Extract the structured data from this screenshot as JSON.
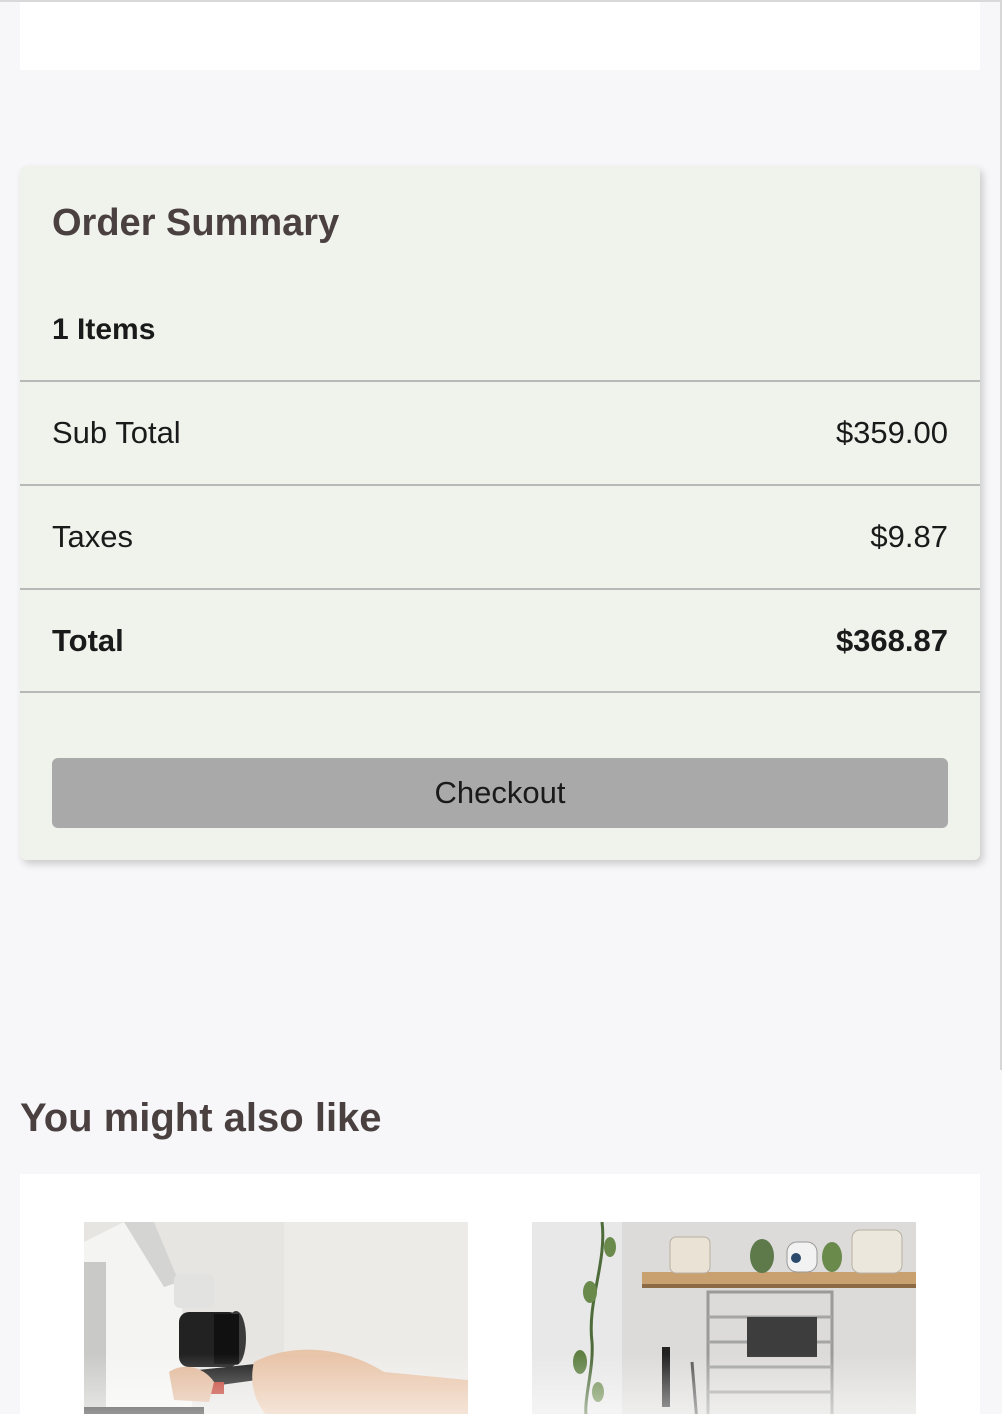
{
  "summary": {
    "title": "Order Summary",
    "items_count": "1 Items",
    "rows": [
      {
        "label": "Sub Total",
        "value": "$359.00"
      },
      {
        "label": "Taxes",
        "value": "$9.87"
      },
      {
        "label": "Total",
        "value": "$368.87"
      }
    ],
    "checkout_label": "Checkout"
  },
  "recommendations": {
    "heading": "You might also like",
    "products": [
      {
        "image": "espresso-machine-photo"
      },
      {
        "image": "kitchen-shelf-rack-photo"
      }
    ]
  },
  "colors": {
    "page_bg": "#f7f7f9",
    "card_bg": "#f0f2ec",
    "heading": "#4a4040",
    "button_bg": "#a9a9a9",
    "divider": "#b8b8b8"
  }
}
